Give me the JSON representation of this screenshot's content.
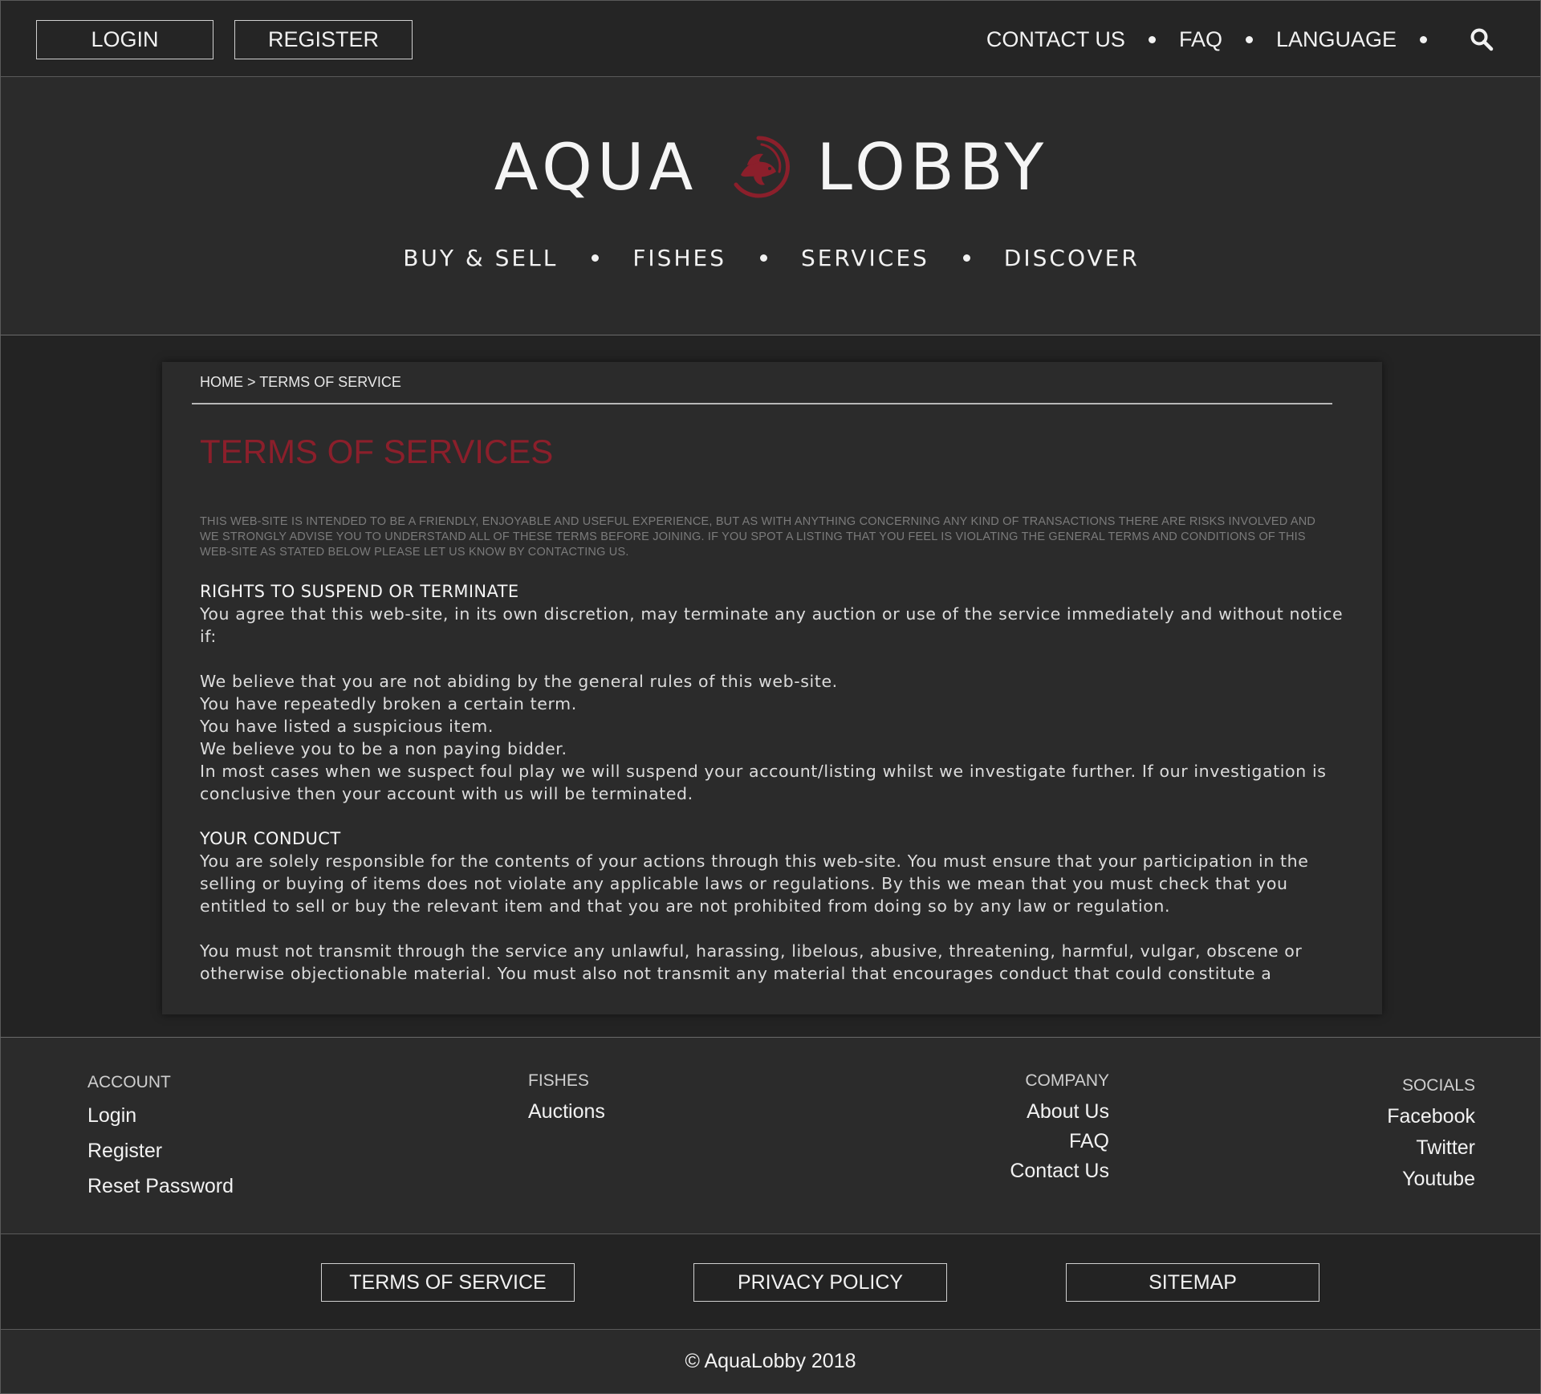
{
  "topbar": {
    "login_label": "LOGIN",
    "register_label": "REGISTER",
    "nav": [
      {
        "label": "CONTACT US"
      },
      {
        "label": "FAQ"
      },
      {
        "label": "LANGUAGE"
      }
    ],
    "search_icon": "search-icon"
  },
  "brand": {
    "left_text": "AQUA",
    "right_text": "LOBBY",
    "logo_icon": "fish-circle-logo",
    "accent_color": "#8b1f2b"
  },
  "main_nav": [
    {
      "label": "BUY & SELL"
    },
    {
      "label": "FISHES"
    },
    {
      "label": "SERVICES"
    },
    {
      "label": "DISCOVER"
    }
  ],
  "content": {
    "breadcrumb": "HOME > TERMS OF SERVICE",
    "title": "TERMS OF SERVICES",
    "intro": "THIS WEB-SITE IS INTENDED TO BE A FRIENDLY, ENJOYABLE AND USEFUL EXPERIENCE, BUT AS WITH ANYTHING CONCERNING ANY KIND OF TRANSACTIONS THERE ARE RISKS INVOLVED AND WE STRONGLY ADVISE YOU TO UNDERSTAND ALL OF THESE TERMS BEFORE JOINING. IF YOU SPOT A LISTING THAT YOU FEEL IS VIOLATING THE GENERAL TERMS AND CONDITIONS OF THIS WEB-SITE AS STATED BELOW PLEASE LET US KNOW BY CONTACTING US.",
    "sections": [
      {
        "heading": "RIGHTS TO SUSPEND OR TERMINATE",
        "p1": "You agree that this web-site, in its own discretion, may terminate any auction or use of the service immediately and without notice if:",
        "lines": [
          "We believe that you are not abiding by the general rules of this web-site.",
          "You have repeatedly broken a certain term.",
          "You have listed a suspicious item.",
          "We believe you to be a non paying bidder.",
          "In most cases when we suspect foul play we will suspend your account/listing whilst we investigate further. If our investigation is conclusive then your account with us will be terminated."
        ]
      },
      {
        "heading": "YOUR CONDUCT",
        "p1": "You are solely responsible for the contents of your actions through this web-site. You must ensure that your participation in the selling or buying of items does not violate any applicable laws or regulations. By this we mean that you must check that you entitled to sell or buy the relevant item and that you are not prohibited from doing so by any law or regulation.",
        "p2": "You must not transmit through the service any unlawful, harassing, libelous, abusive, threatening, harmful, vulgar, obscene or otherwise objectionable material. You must also not transmit any material that encourages conduct that could constitute a"
      }
    ]
  },
  "footer": {
    "account": {
      "heading": "ACCOUNT",
      "links": [
        "Login",
        "Register",
        "Reset Password"
      ]
    },
    "fishes": {
      "heading": "FISHES",
      "links": [
        "Auctions"
      ]
    },
    "company": {
      "heading": "COMPANY",
      "links": [
        "About Us",
        "FAQ",
        "Contact Us"
      ]
    },
    "socials": {
      "heading": "SOCIALS",
      "links": [
        "Facebook",
        "Twitter",
        "Youtube"
      ]
    }
  },
  "legal": {
    "terms_label": "TERMS OF SERVICE",
    "privacy_label": "PRIVACY POLICY",
    "sitemap_label": "SITEMAP"
  },
  "copyright": "© AquaLobby 2018"
}
